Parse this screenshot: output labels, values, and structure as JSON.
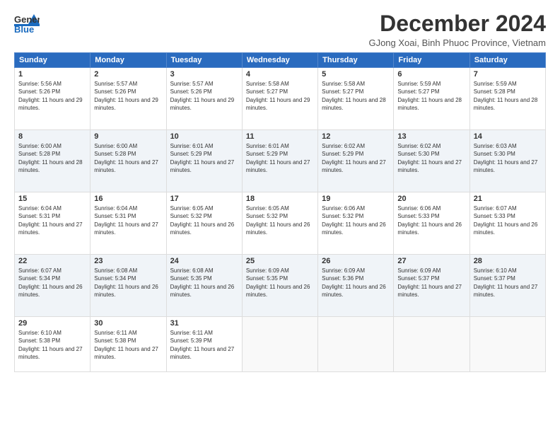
{
  "header": {
    "logo": {
      "line1": "General",
      "line2": "Blue"
    },
    "title": "December 2024",
    "location": "GJong Xoai, Binh Phuoc Province, Vietnam"
  },
  "days_of_week": [
    "Sunday",
    "Monday",
    "Tuesday",
    "Wednesday",
    "Thursday",
    "Friday",
    "Saturday"
  ],
  "weeks": [
    [
      {
        "day": "1",
        "sunrise": "5:56 AM",
        "sunset": "5:26 PM",
        "daylight": "11 hours and 29 minutes."
      },
      {
        "day": "2",
        "sunrise": "5:57 AM",
        "sunset": "5:26 PM",
        "daylight": "11 hours and 29 minutes."
      },
      {
        "day": "3",
        "sunrise": "5:57 AM",
        "sunset": "5:26 PM",
        "daylight": "11 hours and 29 minutes."
      },
      {
        "day": "4",
        "sunrise": "5:58 AM",
        "sunset": "5:27 PM",
        "daylight": "11 hours and 29 minutes."
      },
      {
        "day": "5",
        "sunrise": "5:58 AM",
        "sunset": "5:27 PM",
        "daylight": "11 hours and 28 minutes."
      },
      {
        "day": "6",
        "sunrise": "5:59 AM",
        "sunset": "5:27 PM",
        "daylight": "11 hours and 28 minutes."
      },
      {
        "day": "7",
        "sunrise": "5:59 AM",
        "sunset": "5:28 PM",
        "daylight": "11 hours and 28 minutes."
      }
    ],
    [
      {
        "day": "8",
        "sunrise": "6:00 AM",
        "sunset": "5:28 PM",
        "daylight": "11 hours and 28 minutes."
      },
      {
        "day": "9",
        "sunrise": "6:00 AM",
        "sunset": "5:28 PM",
        "daylight": "11 hours and 27 minutes."
      },
      {
        "day": "10",
        "sunrise": "6:01 AM",
        "sunset": "5:29 PM",
        "daylight": "11 hours and 27 minutes."
      },
      {
        "day": "11",
        "sunrise": "6:01 AM",
        "sunset": "5:29 PM",
        "daylight": "11 hours and 27 minutes."
      },
      {
        "day": "12",
        "sunrise": "6:02 AM",
        "sunset": "5:29 PM",
        "daylight": "11 hours and 27 minutes."
      },
      {
        "day": "13",
        "sunrise": "6:02 AM",
        "sunset": "5:30 PM",
        "daylight": "11 hours and 27 minutes."
      },
      {
        "day": "14",
        "sunrise": "6:03 AM",
        "sunset": "5:30 PM",
        "daylight": "11 hours and 27 minutes."
      }
    ],
    [
      {
        "day": "15",
        "sunrise": "6:04 AM",
        "sunset": "5:31 PM",
        "daylight": "11 hours and 27 minutes."
      },
      {
        "day": "16",
        "sunrise": "6:04 AM",
        "sunset": "5:31 PM",
        "daylight": "11 hours and 27 minutes."
      },
      {
        "day": "17",
        "sunrise": "6:05 AM",
        "sunset": "5:32 PM",
        "daylight": "11 hours and 26 minutes."
      },
      {
        "day": "18",
        "sunrise": "6:05 AM",
        "sunset": "5:32 PM",
        "daylight": "11 hours and 26 minutes."
      },
      {
        "day": "19",
        "sunrise": "6:06 AM",
        "sunset": "5:32 PM",
        "daylight": "11 hours and 26 minutes."
      },
      {
        "day": "20",
        "sunrise": "6:06 AM",
        "sunset": "5:33 PM",
        "daylight": "11 hours and 26 minutes."
      },
      {
        "day": "21",
        "sunrise": "6:07 AM",
        "sunset": "5:33 PM",
        "daylight": "11 hours and 26 minutes."
      }
    ],
    [
      {
        "day": "22",
        "sunrise": "6:07 AM",
        "sunset": "5:34 PM",
        "daylight": "11 hours and 26 minutes."
      },
      {
        "day": "23",
        "sunrise": "6:08 AM",
        "sunset": "5:34 PM",
        "daylight": "11 hours and 26 minutes."
      },
      {
        "day": "24",
        "sunrise": "6:08 AM",
        "sunset": "5:35 PM",
        "daylight": "11 hours and 26 minutes."
      },
      {
        "day": "25",
        "sunrise": "6:09 AM",
        "sunset": "5:35 PM",
        "daylight": "11 hours and 26 minutes."
      },
      {
        "day": "26",
        "sunrise": "6:09 AM",
        "sunset": "5:36 PM",
        "daylight": "11 hours and 26 minutes."
      },
      {
        "day": "27",
        "sunrise": "6:09 AM",
        "sunset": "5:37 PM",
        "daylight": "11 hours and 27 minutes."
      },
      {
        "day": "28",
        "sunrise": "6:10 AM",
        "sunset": "5:37 PM",
        "daylight": "11 hours and 27 minutes."
      }
    ],
    [
      {
        "day": "29",
        "sunrise": "6:10 AM",
        "sunset": "5:38 PM",
        "daylight": "11 hours and 27 minutes."
      },
      {
        "day": "30",
        "sunrise": "6:11 AM",
        "sunset": "5:38 PM",
        "daylight": "11 hours and 27 minutes."
      },
      {
        "day": "31",
        "sunrise": "6:11 AM",
        "sunset": "5:39 PM",
        "daylight": "11 hours and 27 minutes."
      },
      null,
      null,
      null,
      null
    ]
  ],
  "labels": {
    "sunrise": "Sunrise:",
    "sunset": "Sunset:",
    "daylight": "Daylight:"
  }
}
